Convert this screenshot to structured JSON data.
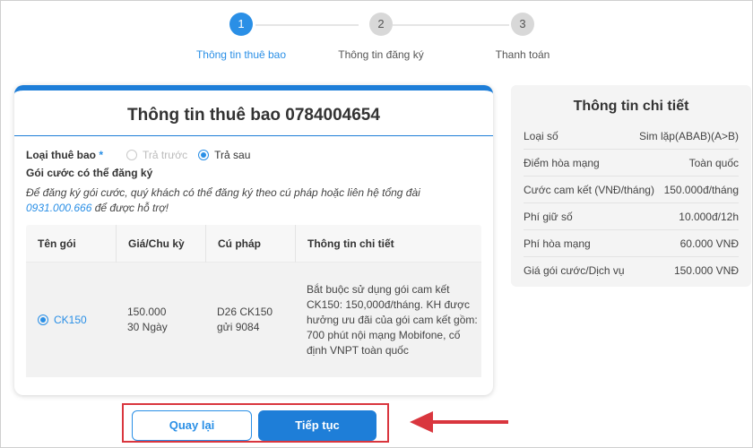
{
  "stepper": {
    "steps": [
      {
        "number": "1",
        "label": "Thông tin thuê bao"
      },
      {
        "number": "2",
        "label": "Thông tin đăng ký"
      },
      {
        "number": "3",
        "label": "Thanh toán"
      }
    ],
    "active_step": 1
  },
  "form": {
    "title": "Thông tin thuê bao 0784004654",
    "subscriber_type_label": "Loại thuê bao",
    "required_mark": "*",
    "options": {
      "prepaid": "Trả trước",
      "postpaid": "Trả sau"
    },
    "selected_option": "Trả sau",
    "packages_title": "Gói cước có thể đăng ký",
    "note_text": "Để đăng ký gói cước, quý khách có thể đăng ký theo cú pháp hoặc liên hệ tổng đài",
    "note_phone": "0931.000.666",
    "note_suffix": "để được hỗ trợ!",
    "table": {
      "headers": [
        "Tên gói",
        "Giá/Chu kỳ",
        "Cú pháp",
        "Thông tin chi tiết"
      ],
      "rows": [
        {
          "name": "CK150",
          "price": "150.000",
          "cycle": "30 Ngày",
          "syntax": "D26 CK150",
          "syntax_send": "gửi 9084",
          "details": "Bắt buộc sử dụng gói cam kết CK150: 150,000đ/tháng. KH được hưởng ưu đãi của gói cam kết gồm: 700 phút nội mạng Mobifone, cố định VNPT toàn quốc",
          "selected": true
        }
      ]
    }
  },
  "buttons": {
    "back": "Quay lại",
    "next": "Tiếp tục"
  },
  "details_panel": {
    "title": "Thông tin chi tiết",
    "rows": [
      {
        "label": "Loại số",
        "value": "Sim lặp(ABAB)(A>B)"
      },
      {
        "label": "Điểm hòa mạng",
        "value": "Toàn quốc"
      },
      {
        "label": "Cước cam kết (VNĐ/tháng)",
        "value": "150.000đ/tháng"
      },
      {
        "label": "Phí giữ số",
        "value": "10.000đ/12h"
      },
      {
        "label": "Phí hòa mạng",
        "value": "60.000 VNĐ"
      },
      {
        "label": "Giá gói cước/Dịch vụ",
        "value": "150.000 VNĐ"
      }
    ]
  },
  "colors": {
    "accent": "#1e7ed8",
    "highlight": "#d9363e"
  }
}
